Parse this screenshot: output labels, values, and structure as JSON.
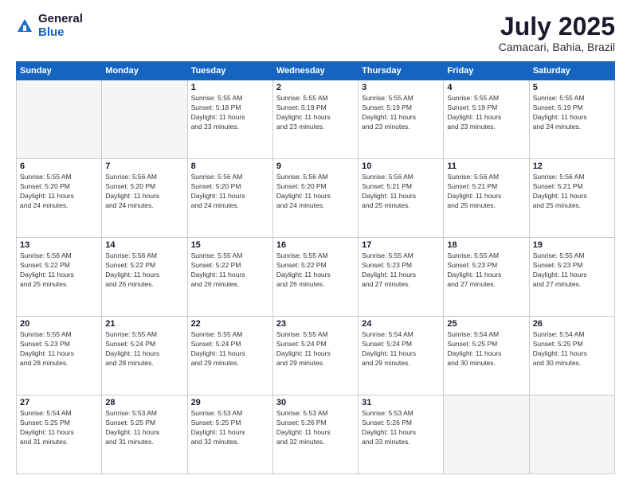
{
  "logo": {
    "general": "General",
    "blue": "Blue"
  },
  "title": {
    "month_year": "July 2025",
    "location": "Camacari, Bahia, Brazil"
  },
  "headers": [
    "Sunday",
    "Monday",
    "Tuesday",
    "Wednesday",
    "Thursday",
    "Friday",
    "Saturday"
  ],
  "weeks": [
    [
      {
        "day": "",
        "info": ""
      },
      {
        "day": "",
        "info": ""
      },
      {
        "day": "1",
        "info": "Sunrise: 5:55 AM\nSunset: 5:18 PM\nDaylight: 11 hours\nand 23 minutes."
      },
      {
        "day": "2",
        "info": "Sunrise: 5:55 AM\nSunset: 5:19 PM\nDaylight: 11 hours\nand 23 minutes."
      },
      {
        "day": "3",
        "info": "Sunrise: 5:55 AM\nSunset: 5:19 PM\nDaylight: 11 hours\nand 23 minutes."
      },
      {
        "day": "4",
        "info": "Sunrise: 5:55 AM\nSunset: 5:19 PM\nDaylight: 11 hours\nand 23 minutes."
      },
      {
        "day": "5",
        "info": "Sunrise: 5:55 AM\nSunset: 5:19 PM\nDaylight: 11 hours\nand 24 minutes."
      }
    ],
    [
      {
        "day": "6",
        "info": "Sunrise: 5:55 AM\nSunset: 5:20 PM\nDaylight: 11 hours\nand 24 minutes."
      },
      {
        "day": "7",
        "info": "Sunrise: 5:56 AM\nSunset: 5:20 PM\nDaylight: 11 hours\nand 24 minutes."
      },
      {
        "day": "8",
        "info": "Sunrise: 5:56 AM\nSunset: 5:20 PM\nDaylight: 11 hours\nand 24 minutes."
      },
      {
        "day": "9",
        "info": "Sunrise: 5:56 AM\nSunset: 5:20 PM\nDaylight: 11 hours\nand 24 minutes."
      },
      {
        "day": "10",
        "info": "Sunrise: 5:56 AM\nSunset: 5:21 PM\nDaylight: 11 hours\nand 25 minutes."
      },
      {
        "day": "11",
        "info": "Sunrise: 5:56 AM\nSunset: 5:21 PM\nDaylight: 11 hours\nand 25 minutes."
      },
      {
        "day": "12",
        "info": "Sunrise: 5:56 AM\nSunset: 5:21 PM\nDaylight: 11 hours\nand 25 minutes."
      }
    ],
    [
      {
        "day": "13",
        "info": "Sunrise: 5:56 AM\nSunset: 5:22 PM\nDaylight: 11 hours\nand 25 minutes."
      },
      {
        "day": "14",
        "info": "Sunrise: 5:56 AM\nSunset: 5:22 PM\nDaylight: 11 hours\nand 26 minutes."
      },
      {
        "day": "15",
        "info": "Sunrise: 5:55 AM\nSunset: 5:22 PM\nDaylight: 11 hours\nand 26 minutes."
      },
      {
        "day": "16",
        "info": "Sunrise: 5:55 AM\nSunset: 5:22 PM\nDaylight: 11 hours\nand 26 minutes."
      },
      {
        "day": "17",
        "info": "Sunrise: 5:55 AM\nSunset: 5:23 PM\nDaylight: 11 hours\nand 27 minutes."
      },
      {
        "day": "18",
        "info": "Sunrise: 5:55 AM\nSunset: 5:23 PM\nDaylight: 11 hours\nand 27 minutes."
      },
      {
        "day": "19",
        "info": "Sunrise: 5:55 AM\nSunset: 5:23 PM\nDaylight: 11 hours\nand 27 minutes."
      }
    ],
    [
      {
        "day": "20",
        "info": "Sunrise: 5:55 AM\nSunset: 5:23 PM\nDaylight: 11 hours\nand 28 minutes."
      },
      {
        "day": "21",
        "info": "Sunrise: 5:55 AM\nSunset: 5:24 PM\nDaylight: 11 hours\nand 28 minutes."
      },
      {
        "day": "22",
        "info": "Sunrise: 5:55 AM\nSunset: 5:24 PM\nDaylight: 11 hours\nand 29 minutes."
      },
      {
        "day": "23",
        "info": "Sunrise: 5:55 AM\nSunset: 5:24 PM\nDaylight: 11 hours\nand 29 minutes."
      },
      {
        "day": "24",
        "info": "Sunrise: 5:54 AM\nSunset: 5:24 PM\nDaylight: 11 hours\nand 29 minutes."
      },
      {
        "day": "25",
        "info": "Sunrise: 5:54 AM\nSunset: 5:25 PM\nDaylight: 11 hours\nand 30 minutes."
      },
      {
        "day": "26",
        "info": "Sunrise: 5:54 AM\nSunset: 5:25 PM\nDaylight: 11 hours\nand 30 minutes."
      }
    ],
    [
      {
        "day": "27",
        "info": "Sunrise: 5:54 AM\nSunset: 5:25 PM\nDaylight: 11 hours\nand 31 minutes."
      },
      {
        "day": "28",
        "info": "Sunrise: 5:53 AM\nSunset: 5:25 PM\nDaylight: 11 hours\nand 31 minutes."
      },
      {
        "day": "29",
        "info": "Sunrise: 5:53 AM\nSunset: 5:25 PM\nDaylight: 11 hours\nand 32 minutes."
      },
      {
        "day": "30",
        "info": "Sunrise: 5:53 AM\nSunset: 5:26 PM\nDaylight: 11 hours\nand 32 minutes."
      },
      {
        "day": "31",
        "info": "Sunrise: 5:53 AM\nSunset: 5:26 PM\nDaylight: 11 hours\nand 33 minutes."
      },
      {
        "day": "",
        "info": ""
      },
      {
        "day": "",
        "info": ""
      }
    ]
  ]
}
